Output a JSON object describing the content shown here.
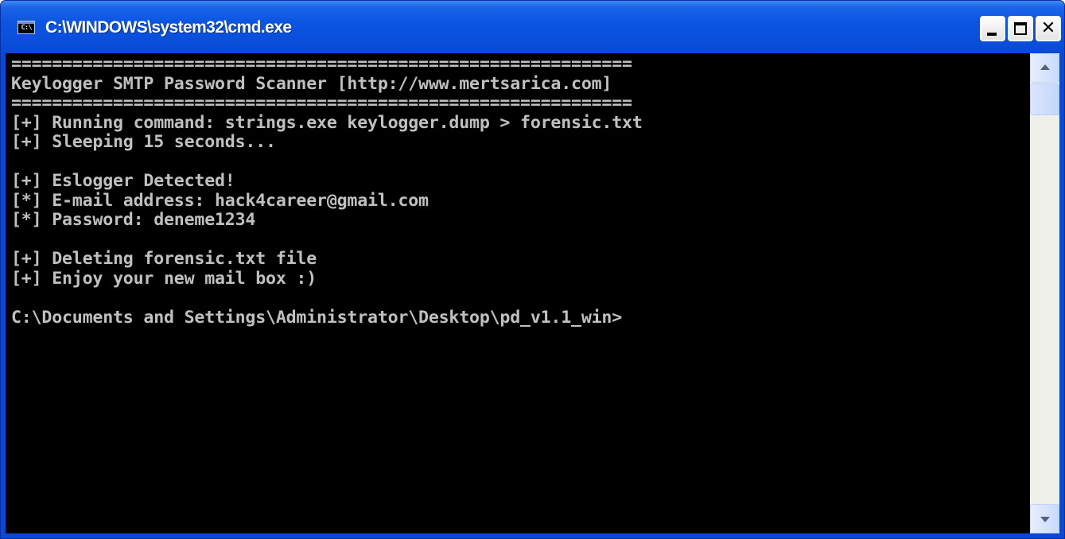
{
  "window": {
    "title": "C:\\WINDOWS\\system32\\cmd.exe",
    "icon": "console-icon",
    "icon_text": "C:\\",
    "controls": {
      "minimize": "minimize-icon",
      "maximize": "maximize-icon",
      "close": "close-icon",
      "close_glyph": "✕"
    }
  },
  "console": {
    "lines": [
      "=============================================================",
      "Keylogger SMTP Password Scanner [http://www.mertsarica.com]",
      "=============================================================",
      "[+] Running command: strings.exe keylogger.dump > forensic.txt",
      "[+] Sleeping 15 seconds...",
      "",
      "[+] Eslogger Detected!",
      "[*] E-mail address: hack4career@gmail.com",
      "[*] Password: deneme1234",
      "",
      "[+] Deleting forensic.txt file",
      "[+] Enjoy your new mail box :)",
      "",
      "C:\\Documents and Settings\\Administrator\\Desktop\\pd_v1.1_win>"
    ]
  },
  "colors": {
    "titlebar": "#0a50dc",
    "console_bg": "#000000",
    "console_text": "#c0c0c0"
  }
}
